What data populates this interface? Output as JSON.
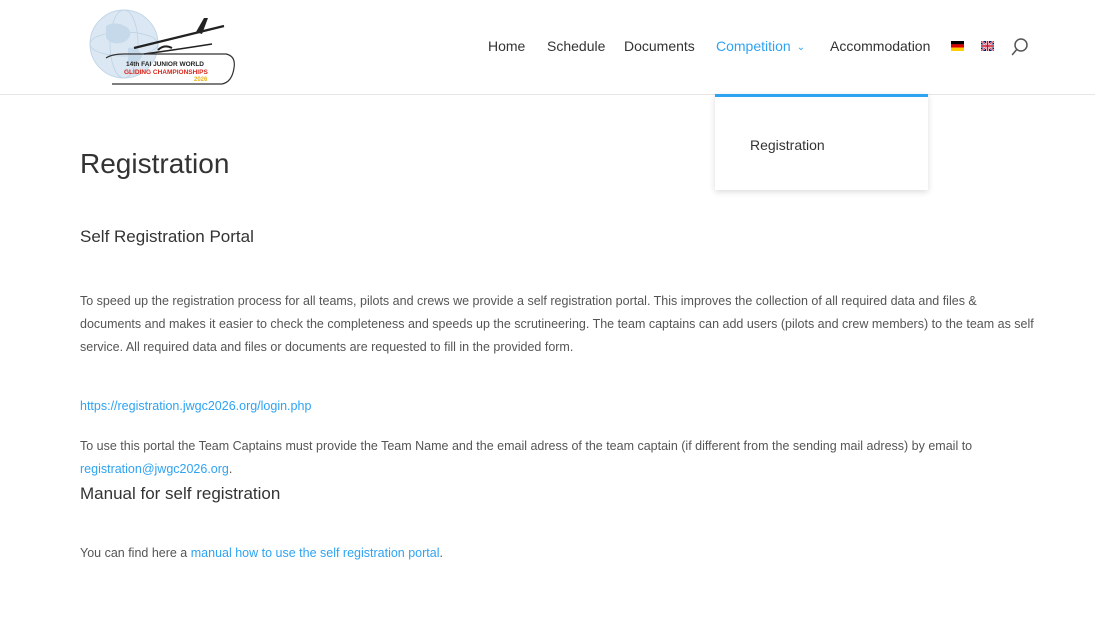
{
  "logo": {
    "line1": "14th FAI JUNIOR WORLD",
    "line2": "GLIDING CHAMPIONSHIPS",
    "year": "2026"
  },
  "nav": {
    "items": [
      {
        "label": "Home"
      },
      {
        "label": "Schedule"
      },
      {
        "label": "Documents"
      },
      {
        "label": "Competition"
      },
      {
        "label": "Accommodation"
      }
    ],
    "active_color": "#2ea3f2"
  },
  "dropdown": {
    "items": [
      {
        "label": "Registration"
      }
    ]
  },
  "page": {
    "title": "Registration",
    "section1_heading": "Self Registration Portal",
    "section1_paragraph": "To speed up the registration process for all teams, pilots and crews we provide a self registration portal. This improves the collection of all required data and files & documents and makes it easier to check the completeness and speeds up the scrutineering. The team captains can add users (pilots and crew members) to the team as self service. All required data and files or documents are requested to fill in the provided form.",
    "portal_link": "https://registration.jwgc2026.org/login.php",
    "section1_paragraph2_before": "To use this portal the Team Captains must provide the Team Name and the email adress of the team captain (if different from the sending mail adress) by email to ",
    "email_link": "registration@jwgc2026.org",
    "section1_paragraph2_after": ".",
    "section2_heading": "Manual for self registration",
    "section2_before": "You can find here a ",
    "manual_link": "manual how to use the self registration portal",
    "section2_after": "."
  }
}
